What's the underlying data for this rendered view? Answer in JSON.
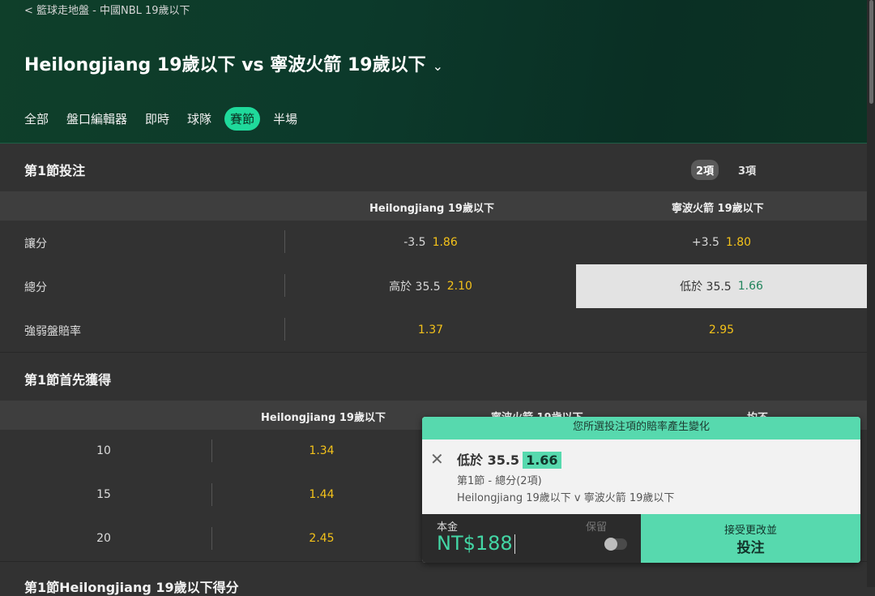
{
  "breadcrumb": "< 籃球走地盤 - 中國NBL 19歲以下",
  "match_title": "Heilongjiang 19歲以下 vs 寧波火箭 19歲以下",
  "tabs": [
    "全部",
    "盤口編輯器",
    "即時",
    "球隊",
    "賽節",
    "半場"
  ],
  "section1": {
    "title": "第1節投注",
    "toggle_on": "2項",
    "toggle_off": "3項",
    "col1": "Heilongjiang 19歲以下",
    "col2": "寧波火箭 19歲以下",
    "rows": [
      {
        "label": "讓分",
        "c1_line": "-3.5",
        "c1_odds": "1.86",
        "c2_line": "+3.5",
        "c2_odds": "1.80"
      },
      {
        "label": "總分",
        "c1_line": "高於 35.5",
        "c1_odds": "2.10",
        "c2_line": "低於 35.5",
        "c2_odds": "1.66"
      },
      {
        "label": "強弱盤賠率",
        "c1_line": "",
        "c1_odds": "1.37",
        "c2_line": "",
        "c2_odds": "2.95"
      }
    ]
  },
  "section2": {
    "title": "第1節首先獲得",
    "col1": "Heilongjiang 19歲以下",
    "col2": "寧波火箭 19歲以下",
    "col3": "均不",
    "rows": [
      {
        "label": "10",
        "c1_odds": "1.34"
      },
      {
        "label": "15",
        "c1_odds": "1.44"
      },
      {
        "label": "20",
        "c1_odds": "2.45"
      }
    ]
  },
  "section3": {
    "title": "第1節Heilongjiang 19歲以下得分"
  },
  "betslip": {
    "notice": "您所選投注項的賠率產生變化",
    "selection": "低於 35.5",
    "odds": "1.66",
    "market": "第1節 - 總分(2項)",
    "match": "Heilongjiang 19歲以下 v 寧波火箭 19歲以下",
    "stake_label": "本金",
    "stake_value": "NT$188",
    "keep_label": "保留",
    "accept_line1": "接受更改並",
    "accept_line2": "投注"
  },
  "colors": {
    "accent": "#1fd99b",
    "odds": "#f4c21a",
    "slip_green": "#57d9ae",
    "header_green": "#0f3f2a"
  }
}
